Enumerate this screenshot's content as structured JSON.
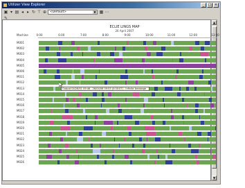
{
  "window": {
    "title": "Utilizer View Explorer"
  },
  "toolbar": {
    "view_combo": "<Default>"
  },
  "chart": {
    "title": "ECLIE LINGS MAP",
    "date": "26 April 2007",
    "row_header": "Machine",
    "times": [
      "0:00",
      "6:00",
      "7:00",
      "8:00",
      "9:00",
      "10:00",
      "11:00",
      "12:00",
      "13:00"
    ],
    "rows": [
      "M001",
      "M002",
      "M003",
      "M004",
      "M005",
      "M006",
      "M011",
      "M012",
      "M013",
      "M014",
      "M015",
      "M016",
      "M017",
      "M018",
      "M019",
      "M020",
      "M021",
      "M022",
      "M023",
      "M024",
      "M025",
      "M026"
    ]
  },
  "tooltip": {
    "text": "Output 04/26/01 09:46 - 26/04/06 09:53 (0:00:07) - Infinite breakage"
  },
  "colors": {
    "running": "#6aa84f",
    "idle": "#2e3f9e",
    "setup": "#8e3fa0",
    "fault": "#d05090",
    "light": "#b8c8f0"
  }
}
